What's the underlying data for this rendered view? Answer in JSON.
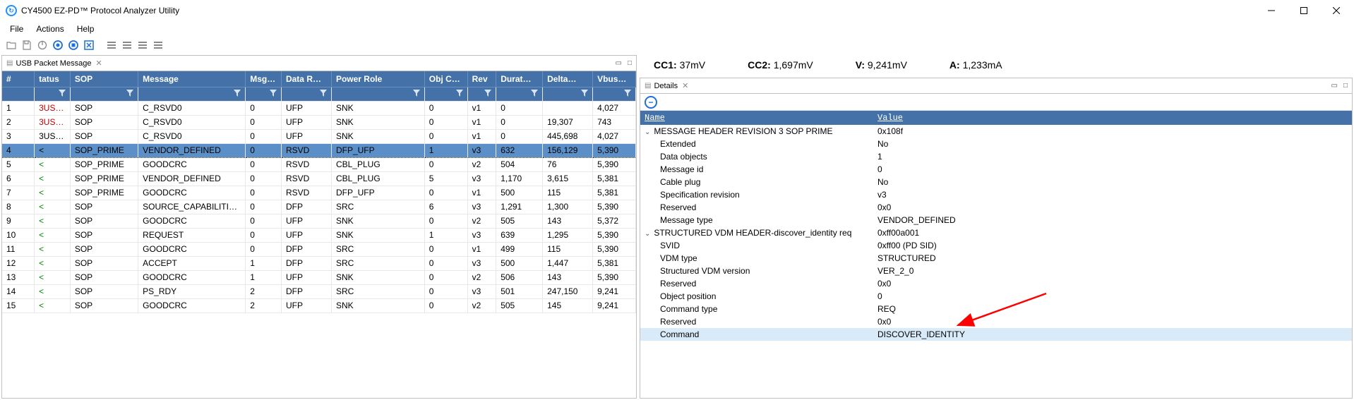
{
  "window": {
    "title": "CY4500 EZ-PD™ Protocol Analyzer Utility"
  },
  "menus": [
    "File",
    "Actions",
    "Help"
  ],
  "panes": {
    "packets_tab": "USB Packet Message",
    "packets_tab_close": "✕",
    "details_tab": "Details",
    "details_tab_close": "✕"
  },
  "columns": [
    "#",
    "tatus",
    "SOP",
    "Message",
    "Msg…",
    "Data R…",
    "Power Role",
    "Obj C…",
    "Rev",
    "Durat…",
    "Delta…",
    "Vbus…"
  ],
  "rows": [
    {
      "n": "1",
      "status": "3US_…",
      "sclass": "status-red",
      "sop": "SOP",
      "msg": "C_RSVD0",
      "mid": "0",
      "data": "UFP",
      "pr": "SNK",
      "oc": "0",
      "rev": "v1",
      "dur": "0",
      "delta": "",
      "vbus": "4,027"
    },
    {
      "n": "2",
      "status": "3US_…",
      "sclass": "status-red",
      "sop": "SOP",
      "msg": "C_RSVD0",
      "mid": "0",
      "data": "UFP",
      "pr": "SNK",
      "oc": "0",
      "rev": "v1",
      "dur": "0",
      "delta": "19,307",
      "vbus": "743"
    },
    {
      "n": "3",
      "status": "3US_…",
      "sclass": "",
      "sop": "SOP",
      "msg": "C_RSVD0",
      "mid": "0",
      "data": "UFP",
      "pr": "SNK",
      "oc": "0",
      "rev": "v1",
      "dur": "0",
      "delta": "445,698",
      "vbus": "4,027"
    },
    {
      "n": "4",
      "status": "<",
      "sclass": "status-green",
      "sop": "SOP_PRIME",
      "msg": "VENDOR_DEFINED",
      "mid": "0",
      "data": "RSVD",
      "pr": "DFP_UFP",
      "oc": "1",
      "rev": "v3",
      "dur": "632",
      "delta": "156,129",
      "vbus": "5,390",
      "selected": true
    },
    {
      "n": "5",
      "status": "<",
      "sclass": "status-green",
      "sop": "SOP_PRIME",
      "msg": "GOODCRC",
      "mid": "0",
      "data": "RSVD",
      "pr": "CBL_PLUG",
      "oc": "0",
      "rev": "v2",
      "dur": "504",
      "delta": "76",
      "vbus": "5,390"
    },
    {
      "n": "6",
      "status": "<",
      "sclass": "status-green",
      "sop": "SOP_PRIME",
      "msg": "VENDOR_DEFINED",
      "mid": "0",
      "data": "RSVD",
      "pr": "CBL_PLUG",
      "oc": "5",
      "rev": "v3",
      "dur": "1,170",
      "delta": "3,615",
      "vbus": "5,381"
    },
    {
      "n": "7",
      "status": "<",
      "sclass": "status-green",
      "sop": "SOP_PRIME",
      "msg": "GOODCRC",
      "mid": "0",
      "data": "RSVD",
      "pr": "DFP_UFP",
      "oc": "0",
      "rev": "v1",
      "dur": "500",
      "delta": "115",
      "vbus": "5,381"
    },
    {
      "n": "8",
      "status": "<",
      "sclass": "status-green",
      "sop": "SOP",
      "msg": "SOURCE_CAPABILITI…",
      "mid": "0",
      "data": "DFP",
      "pr": "SRC",
      "oc": "6",
      "rev": "v3",
      "dur": "1,291",
      "delta": "1,300",
      "vbus": "5,390"
    },
    {
      "n": "9",
      "status": "<",
      "sclass": "status-green",
      "sop": "SOP",
      "msg": "GOODCRC",
      "mid": "0",
      "data": "UFP",
      "pr": "SNK",
      "oc": "0",
      "rev": "v2",
      "dur": "505",
      "delta": "143",
      "vbus": "5,372"
    },
    {
      "n": "10",
      "status": "<",
      "sclass": "status-green",
      "sop": "SOP",
      "msg": "REQUEST",
      "mid": "0",
      "data": "UFP",
      "pr": "SNK",
      "oc": "1",
      "rev": "v3",
      "dur": "639",
      "delta": "1,295",
      "vbus": "5,390"
    },
    {
      "n": "11",
      "status": "<",
      "sclass": "status-green",
      "sop": "SOP",
      "msg": "GOODCRC",
      "mid": "0",
      "data": "DFP",
      "pr": "SRC",
      "oc": "0",
      "rev": "v1",
      "dur": "499",
      "delta": "115",
      "vbus": "5,390"
    },
    {
      "n": "12",
      "status": "<",
      "sclass": "status-green",
      "sop": "SOP",
      "msg": "ACCEPT",
      "mid": "1",
      "data": "DFP",
      "pr": "SRC",
      "oc": "0",
      "rev": "v3",
      "dur": "500",
      "delta": "1,447",
      "vbus": "5,381"
    },
    {
      "n": "13",
      "status": "<",
      "sclass": "status-green",
      "sop": "SOP",
      "msg": "GOODCRC",
      "mid": "1",
      "data": "UFP",
      "pr": "SNK",
      "oc": "0",
      "rev": "v2",
      "dur": "506",
      "delta": "143",
      "vbus": "5,390"
    },
    {
      "n": "14",
      "status": "<",
      "sclass": "status-green",
      "sop": "SOP",
      "msg": "PS_RDY",
      "mid": "2",
      "data": "DFP",
      "pr": "SRC",
      "oc": "0",
      "rev": "v3",
      "dur": "501",
      "delta": "247,150",
      "vbus": "9,241"
    },
    {
      "n": "15",
      "status": "<",
      "sclass": "status-green",
      "sop": "SOP",
      "msg": "GOODCRC",
      "mid": "2",
      "data": "UFP",
      "pr": "SNK",
      "oc": "0",
      "rev": "v2",
      "dur": "505",
      "delta": "145",
      "vbus": "9,241"
    }
  ],
  "measurements": {
    "cc1_label": "CC1:",
    "cc1": "37mV",
    "cc2_label": "CC2:",
    "cc2": "1,697mV",
    "v_label": "V:",
    "v": "9,241mV",
    "a_label": "A:",
    "a": "1,233mA"
  },
  "details_headers": [
    "Name",
    "Value",
    ""
  ],
  "details": [
    {
      "name": "MESSAGE HEADER REVISION 3 SOP PRIME",
      "value": "0x108f",
      "level": 0,
      "expand": true
    },
    {
      "name": "Extended",
      "value": "No",
      "level": 1
    },
    {
      "name": "Data objects",
      "value": "1",
      "level": 1
    },
    {
      "name": "Message id",
      "value": "0",
      "level": 1
    },
    {
      "name": "Cable plug",
      "value": "No",
      "level": 1
    },
    {
      "name": "Specification revision",
      "value": "v3",
      "level": 1
    },
    {
      "name": "Reserved",
      "value": "0x0",
      "level": 1
    },
    {
      "name": "Message type",
      "value": "VENDOR_DEFINED",
      "level": 1
    },
    {
      "name": "STRUCTURED VDM HEADER-discover_identity req",
      "value": "0xff00a001",
      "level": 0,
      "expand": true
    },
    {
      "name": "SVID",
      "value": "0xff00 (PD SID)",
      "level": 1
    },
    {
      "name": "VDM type",
      "value": "STRUCTURED",
      "level": 1
    },
    {
      "name": "Structured VDM version",
      "value": "VER_2_0",
      "level": 1
    },
    {
      "name": "Reserved",
      "value": "0x0",
      "level": 1
    },
    {
      "name": "Object position",
      "value": "0",
      "level": 1
    },
    {
      "name": "Command type",
      "value": "REQ",
      "level": 1
    },
    {
      "name": "Reserved",
      "value": "0x0",
      "level": 1
    },
    {
      "name": "Command",
      "value": "DISCOVER_IDENTITY",
      "level": 1,
      "highlight": true
    }
  ]
}
